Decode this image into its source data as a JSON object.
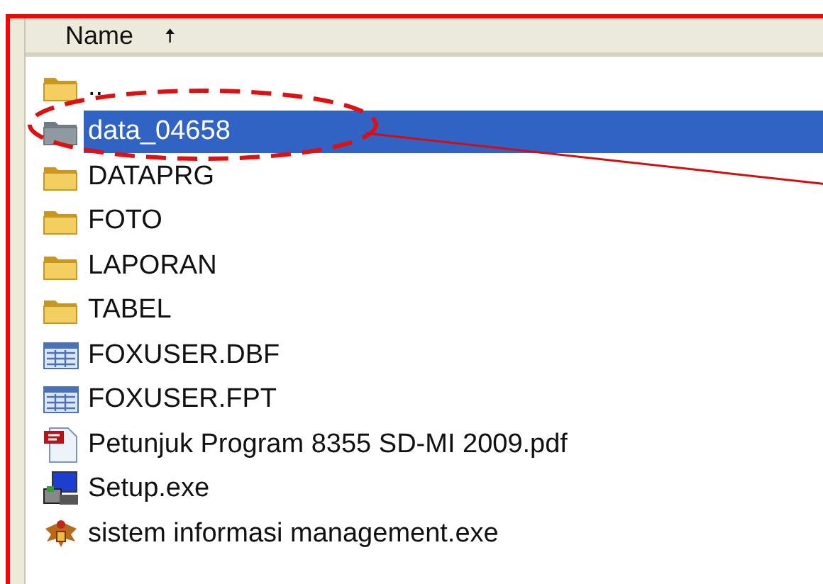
{
  "column_header": {
    "label": "Name",
    "sort_icon": "🠅"
  },
  "files": [
    {
      "name": "..",
      "kind": "folder",
      "selected": false
    },
    {
      "name": "data_04658",
      "kind": "folder",
      "selected": true
    },
    {
      "name": "DATAPRG",
      "kind": "folder",
      "selected": false
    },
    {
      "name": "FOTO",
      "kind": "folder",
      "selected": false
    },
    {
      "name": "LAPORAN",
      "kind": "folder",
      "selected": false
    },
    {
      "name": "TABEL",
      "kind": "folder",
      "selected": false
    },
    {
      "name": "FOXUSER.DBF",
      "kind": "table",
      "selected": false
    },
    {
      "name": "FOXUSER.FPT",
      "kind": "table",
      "selected": false
    },
    {
      "name": "Petunjuk Program 8355 SD-MI 2009.pdf",
      "kind": "pdf",
      "selected": false
    },
    {
      "name": "Setup.exe",
      "kind": "setup",
      "selected": false
    },
    {
      "name": "sistem informasi management.exe",
      "kind": "emblem",
      "selected": false
    }
  ]
}
